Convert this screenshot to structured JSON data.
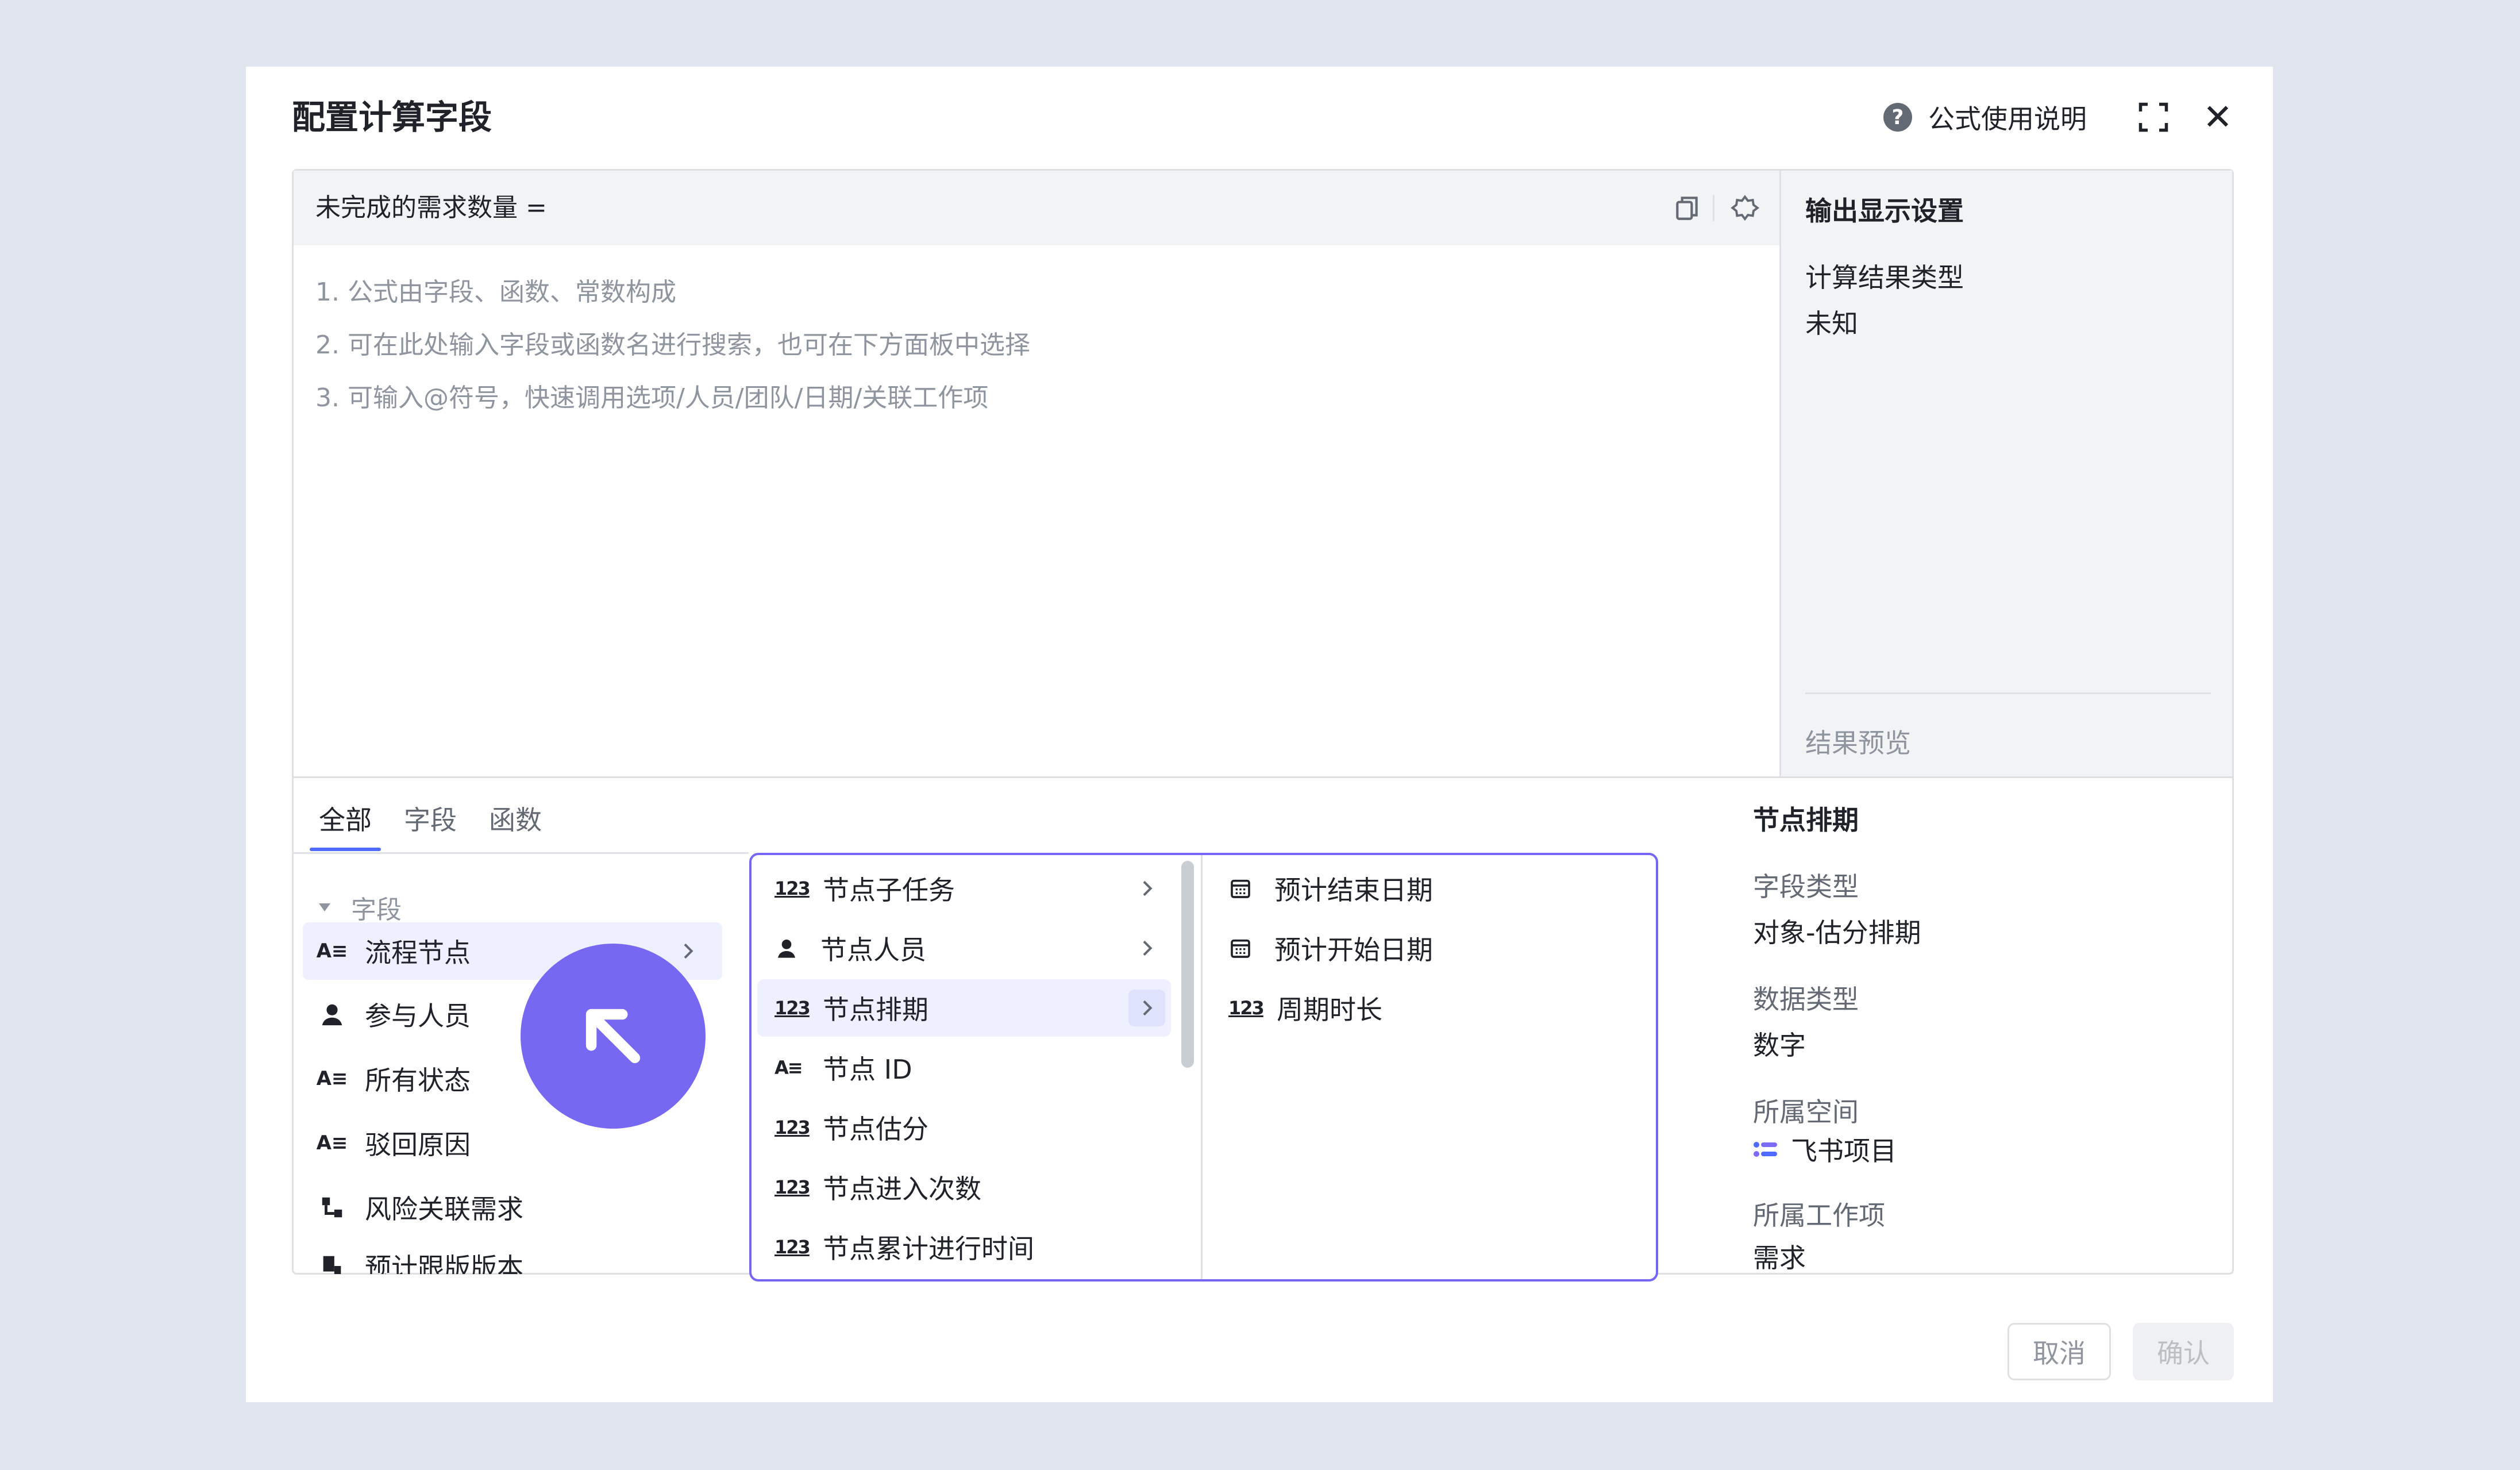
{
  "dialog": {
    "title": "配置计算字段",
    "help_label": "公式使用说明",
    "help_icon": "question-circle-icon",
    "fullscreen_icon": "fullscreen-icon",
    "close_icon": "close-icon"
  },
  "editor": {
    "formula_name": "未完成的需求数量 =",
    "hints": [
      "1. 公式由字段、函数、常数构成",
      "2. 可在此处输入字段或函数名进行搜索，也可在下方面板中选择",
      "3. 可输入@符号，快速调用选项/人员/团队/日期/关联工作项"
    ]
  },
  "output_settings": {
    "title": "输出显示设置",
    "result_type_label": "计算结果类型",
    "result_type_value": "未知",
    "preview_label": "结果预览"
  },
  "tabs": [
    {
      "label": "全部",
      "active": true
    },
    {
      "label": "字段",
      "active": false
    },
    {
      "label": "函数",
      "active": false
    }
  ],
  "field_group": {
    "title": "字段",
    "items": [
      {
        "label": "流程节点",
        "icon": "text-field-icon",
        "active": true
      },
      {
        "label": "参与人员",
        "icon": "person-icon",
        "active": false
      },
      {
        "label": "所有状态",
        "icon": "text-field-icon",
        "active": false
      },
      {
        "label": "驳回原因",
        "icon": "text-field-icon",
        "active": false
      },
      {
        "label": "风险关联需求",
        "icon": "relation-icon",
        "active": false
      },
      {
        "label": "预计跟版版本",
        "icon": "version-icon",
        "active": false
      }
    ]
  },
  "submenu": {
    "items": [
      {
        "label": "节点子任务",
        "icon": "number-icon",
        "has_children": true
      },
      {
        "label": "节点人员",
        "icon": "person-icon",
        "has_children": true
      },
      {
        "label": "节点排期",
        "icon": "number-icon",
        "has_children": true,
        "active": true
      },
      {
        "label": "节点 ID",
        "icon": "text-field-icon"
      },
      {
        "label": "节点估分",
        "icon": "number-icon"
      },
      {
        "label": "节点进入次数",
        "icon": "number-icon"
      },
      {
        "label": "节点累计进行时间",
        "icon": "number-icon"
      }
    ],
    "children": [
      {
        "label": "预计结束日期",
        "icon": "calendar-icon"
      },
      {
        "label": "预计开始日期",
        "icon": "calendar-icon"
      },
      {
        "label": "周期时长",
        "icon": "number-icon"
      }
    ]
  },
  "detail": {
    "title": "节点排期",
    "field_type_label": "字段类型",
    "field_type_value": "对象-估分排期",
    "data_type_label": "数据类型",
    "data_type_value": "数字",
    "space_label": "所属空间",
    "space_value": "飞书项目",
    "work_item_label": "所属工作项",
    "work_item_value": "需求"
  },
  "footer": {
    "cancel_label": "取消",
    "confirm_label": "确认"
  },
  "colors": {
    "accent": "#4e6bfe",
    "highlight_border": "#7566f5",
    "cursor_bubble": "#7668f0",
    "active_row": "#eef0ff"
  }
}
